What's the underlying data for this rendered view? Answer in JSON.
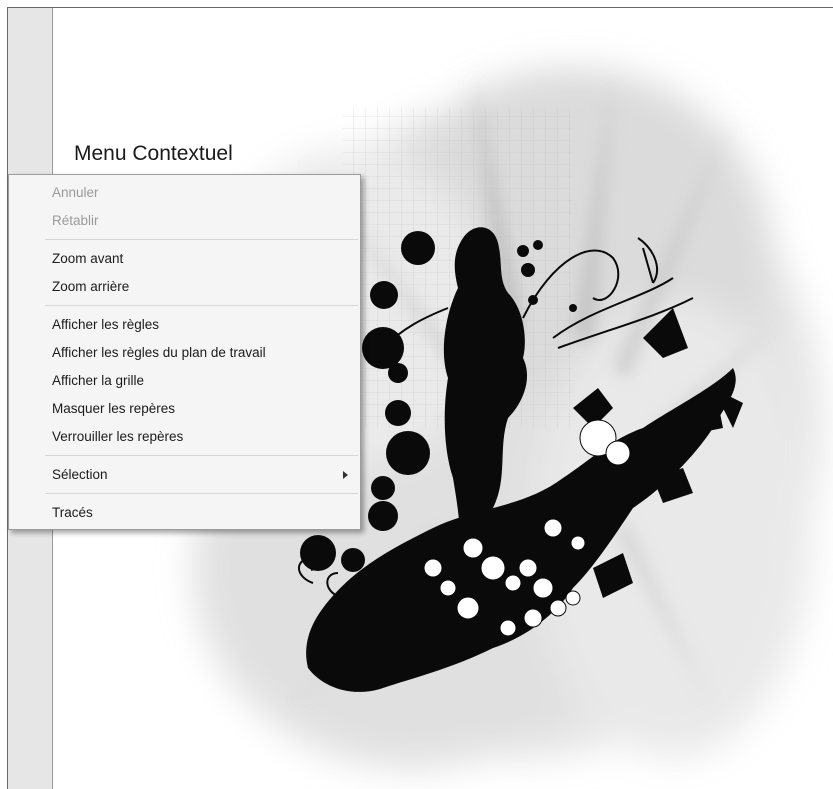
{
  "page": {
    "title": "Menu Contextuel"
  },
  "context_menu": {
    "groups": [
      {
        "items": [
          {
            "label": "Annuler",
            "enabled": false
          },
          {
            "label": "Rétablir",
            "enabled": false
          }
        ]
      },
      {
        "items": [
          {
            "label": "Zoom avant",
            "enabled": true
          },
          {
            "label": "Zoom arrière",
            "enabled": true
          }
        ]
      },
      {
        "items": [
          {
            "label": "Afficher les règles",
            "enabled": true
          },
          {
            "label": "Afficher les règles du plan de travail",
            "enabled": true
          },
          {
            "label": "Afficher la grille",
            "enabled": true
          },
          {
            "label": "Masquer les repères",
            "enabled": true
          },
          {
            "label": "Verrouiller les repères",
            "enabled": true
          }
        ]
      },
      {
        "items": [
          {
            "label": "Sélection",
            "enabled": true,
            "has_submenu": true
          }
        ]
      },
      {
        "items": [
          {
            "label": "Tracés",
            "enabled": true
          }
        ]
      }
    ]
  },
  "icons": {
    "submenu": "chevron-right-icon"
  },
  "colors": {
    "menu_background": "#f5f5f5",
    "disabled_text": "#9a9a9a",
    "enabled_text": "#1b1b1b"
  }
}
